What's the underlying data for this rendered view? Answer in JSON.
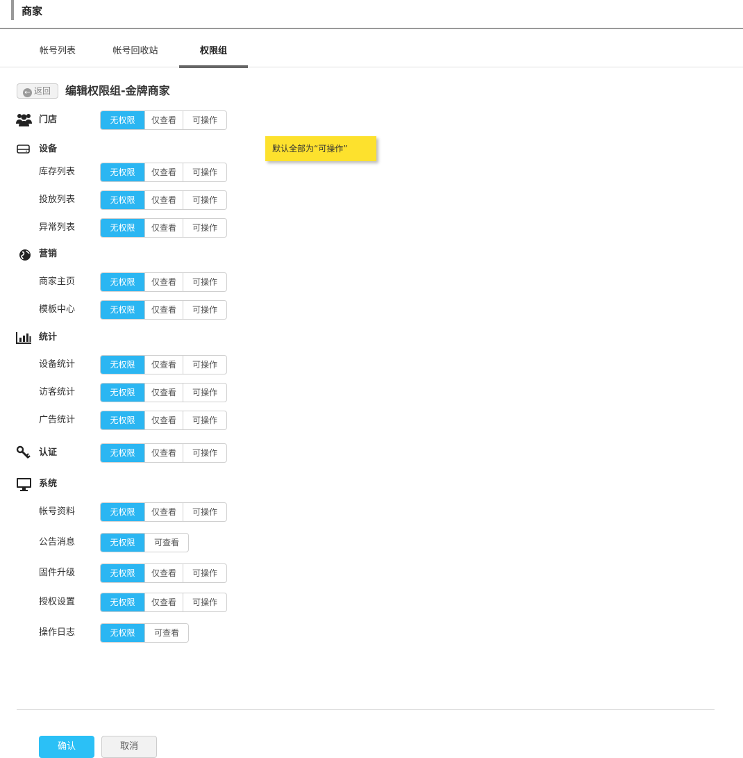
{
  "header": {
    "title": "商家"
  },
  "tabs": [
    {
      "label": "帐号列表",
      "active": false
    },
    {
      "label": "帐号回收站",
      "active": false
    },
    {
      "label": "权限组",
      "active": true
    }
  ],
  "back_label": "返回",
  "page_title": "编辑权限组-金牌商家",
  "note": "默认全部为“可操作”",
  "options": {
    "none": "无权限",
    "view": "仅查看",
    "operate": "可操作",
    "can_view": "可查看"
  },
  "sections": {
    "store": {
      "label": "门店",
      "icon": "users-icon"
    },
    "device": {
      "label": "设备",
      "icon": "hard-drive-icon",
      "items": [
        "库存列表",
        "投放列表",
        "异常列表"
      ]
    },
    "marketing": {
      "label": "营销",
      "icon": "globe-icon",
      "items": [
        "商家主页",
        "模板中心"
      ]
    },
    "stats": {
      "label": "统计",
      "icon": "bar-chart-icon",
      "items": [
        "设备统计",
        "访客统计",
        "广告统计"
      ]
    },
    "auth": {
      "label": "认证",
      "icon": "key-icon"
    },
    "system": {
      "label": "系统",
      "icon": "monitor-icon",
      "items": [
        "帐号资料",
        "公告消息",
        "固件升级",
        "授权设置",
        "操作日志"
      ]
    }
  },
  "selected": "无权限",
  "accent_color": "#2bb6f2",
  "note_color": "#fde12d",
  "buttons": {
    "confirm": "确认",
    "cancel": "取消"
  }
}
